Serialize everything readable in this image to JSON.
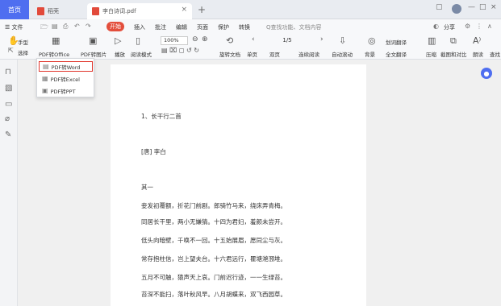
{
  "titlebar": {
    "home_tab": "首页",
    "tab1_label": "稻壳",
    "tab2_label": "李白诗词.pdf",
    "tab2_close": "×",
    "new_tab": "+",
    "window_controls": [
      "▢",
      "—",
      "□",
      "×"
    ]
  },
  "menu": {
    "file": "☰ 文件",
    "start": "开始",
    "items": [
      "插入",
      "批注",
      "编辑",
      "页面",
      "保护",
      "转换"
    ],
    "search_hint": "Q查找功能、文档内容",
    "share": "分享"
  },
  "ribbon": {
    "hand": "手型",
    "select": "选择",
    "pdf_to_office": "PDF转Office",
    "pdf_to_image": "PDF转图片",
    "play": "播放",
    "read_mode": "阅读模式",
    "zoom": "100%",
    "rotate": "旋转文档",
    "page_indicator": "1/5",
    "single_page": "单页",
    "double_page": "双页",
    "continuous": "连续阅读",
    "auto_scroll": "自动滚动",
    "background": "背景",
    "translate": "划词翻译",
    "full_translate": "全文翻译",
    "compress": "压缩",
    "screenshot": "截图和对比",
    "read_aloud": "朗读",
    "find": "查找"
  },
  "dropdown": {
    "items": [
      "PDF转Word",
      "PDF转Excel",
      "PDF转PPT"
    ],
    "selected": "PDF转Word"
  },
  "document": {
    "heading": "1、长干行二首",
    "author": "[唐] 李白",
    "section": "其一",
    "lines": [
      "妾发初覆额，折花门前剧。郎骑竹马来，绕床弄青梅。",
      "同居长干里，两小无嫌猜。十四为君妇，羞颜未尝开。",
      "低头向暗壁，千唤不一回。十五始展眉，愿同尘与灰。",
      "常存抱柱信，岂上望夫台。十六君远行，瞿塘滟滪堆。",
      "五月不可触，猿声天上哀。门前迟行迹，一一生绿苔。",
      "苔深不能扫，落叶秋风早。八月胡蝶来，双飞西园草。"
    ]
  },
  "colors": {
    "accent": "#4f6ef0",
    "start_button": "#e34e3c",
    "selection_border": "#e0352b"
  }
}
